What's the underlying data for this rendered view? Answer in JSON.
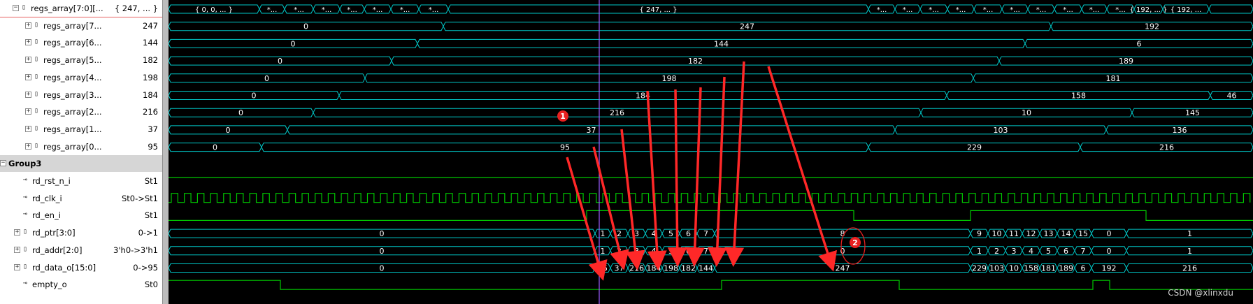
{
  "signals": [
    {
      "name": "regs_array[7:0][...",
      "value": "{ 247, ... }",
      "kind": "bus-expanded"
    },
    {
      "name": "regs_array[7...",
      "value": "247",
      "kind": "bus"
    },
    {
      "name": "regs_array[6...",
      "value": "144",
      "kind": "bus"
    },
    {
      "name": "regs_array[5...",
      "value": "182",
      "kind": "bus"
    },
    {
      "name": "regs_array[4...",
      "value": "198",
      "kind": "bus"
    },
    {
      "name": "regs_array[3...",
      "value": "184",
      "kind": "bus"
    },
    {
      "name": "regs_array[2...",
      "value": "216",
      "kind": "bus"
    },
    {
      "name": "regs_array[1...",
      "value": "37",
      "kind": "bus"
    },
    {
      "name": "regs_array[0...",
      "value": "95",
      "kind": "bus"
    },
    {
      "name": "Group3",
      "value": "",
      "kind": "group"
    },
    {
      "name": "rd_rst_n_i",
      "value": "St1",
      "kind": "wire"
    },
    {
      "name": "rd_clk_i",
      "value": "St0->St1",
      "kind": "wire"
    },
    {
      "name": "rd_en_i",
      "value": "St1",
      "kind": "wire"
    },
    {
      "name": "rd_ptr[3:0]",
      "value": "0->1",
      "kind": "bus"
    },
    {
      "name": "rd_addr[2:0]",
      "value": "3'h0->3'h1",
      "kind": "bus"
    },
    {
      "name": "rd_data_o[15:0]",
      "value": "0->95",
      "kind": "bus"
    },
    {
      "name": "empty_o",
      "value": "St0",
      "kind": "wire"
    }
  ],
  "waves": {
    "regs_array_all": {
      "labels": [
        "{ 0, 0, ... }",
        "*...",
        "*...",
        "*...",
        "*...",
        "*...",
        "*...",
        "*...",
        "{ 247, ... }",
        "*...",
        "*...",
        "*...",
        "*...",
        "*...",
        "*...",
        "*...",
        "*...",
        "*...",
        "*...",
        "{ 192, ... }",
        "{ 192, ..."
      ]
    },
    "regs_array_7": [
      "0",
      "247",
      "192"
    ],
    "regs_array_6": [
      "0",
      "144",
      "6"
    ],
    "regs_array_5": [
      "0",
      "182",
      "189"
    ],
    "regs_array_4": [
      "0",
      "198",
      "181"
    ],
    "regs_array_3": [
      "0",
      "184",
      "158",
      "46"
    ],
    "regs_array_2": [
      "0",
      "216",
      "10",
      "145"
    ],
    "regs_array_1": [
      "0",
      "37",
      "103",
      "136"
    ],
    "regs_array_0": [
      "0",
      "95",
      "229",
      "216"
    ],
    "rd_ptr": [
      "0",
      "1",
      "2",
      "3",
      "4",
      "5",
      "6",
      "7",
      "8",
      "9",
      "10",
      "11",
      "12",
      "13",
      "14",
      "15",
      "0",
      "1"
    ],
    "rd_addr": [
      "0",
      "1",
      "2",
      "3",
      "4",
      "5",
      "6",
      "7",
      "0",
      "1",
      "2",
      "3",
      "4",
      "5",
      "6",
      "7",
      "0",
      "1"
    ],
    "rd_data_o": [
      "0",
      "95",
      "37",
      "216",
      "184",
      "198",
      "182",
      "144",
      "247",
      "229",
      "103",
      "10",
      "158",
      "181",
      "189",
      "6",
      "192",
      "216"
    ]
  },
  "annotations": {
    "marker1": "1",
    "marker2": "2"
  },
  "watermark": "CSDN @xlinxdu",
  "colors": {
    "bus": "#00c8c8",
    "wire": "#00c800",
    "text": "#ffffff",
    "cursor": "#9c5cff",
    "arrow": "#ff2828",
    "marker": "#e82020"
  }
}
